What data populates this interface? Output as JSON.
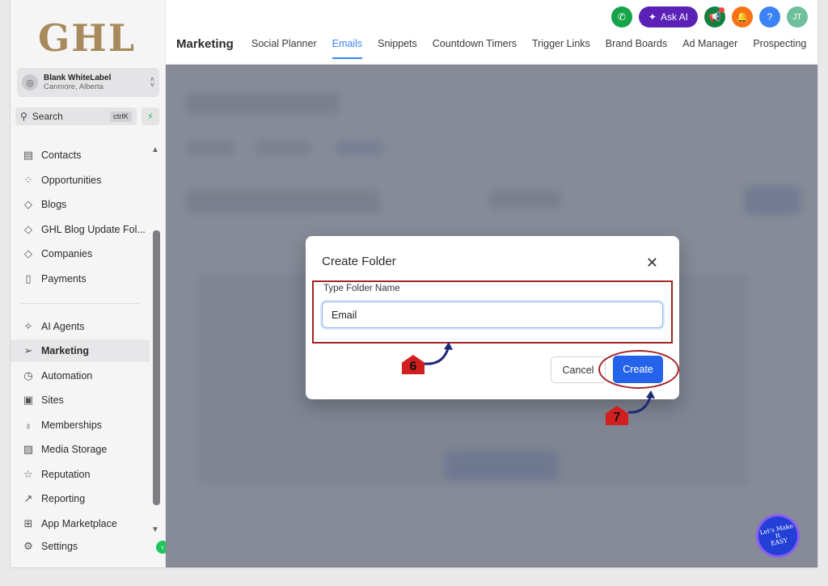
{
  "logo": "GHL",
  "account": {
    "name": "Blank WhiteLabel",
    "location": "Canmore, Alberta"
  },
  "search": {
    "label": "Search",
    "shortcut": "ctrlK"
  },
  "sidebar": {
    "items": [
      {
        "label": "Contacts",
        "icon": "contacts-icon"
      },
      {
        "label": "Opportunities",
        "icon": "opportunities-icon"
      },
      {
        "label": "Blogs",
        "icon": "blogs-icon"
      },
      {
        "label": "GHL Blog Update Fol...",
        "icon": "folder-icon"
      },
      {
        "label": "Companies",
        "icon": "companies-icon"
      },
      {
        "label": "Payments",
        "icon": "payments-icon"
      },
      {
        "label": "AI Agents",
        "icon": "sparkle-icon"
      },
      {
        "label": "Marketing",
        "icon": "send-icon"
      },
      {
        "label": "Automation",
        "icon": "automation-icon"
      },
      {
        "label": "Sites",
        "icon": "sites-icon"
      },
      {
        "label": "Memberships",
        "icon": "memberships-icon"
      },
      {
        "label": "Media Storage",
        "icon": "image-icon"
      },
      {
        "label": "Reputation",
        "icon": "star-icon"
      },
      {
        "label": "Reporting",
        "icon": "chart-icon"
      },
      {
        "label": "App Marketplace",
        "icon": "grid-icon"
      },
      {
        "label": "Settings",
        "icon": "gear-icon"
      }
    ]
  },
  "header": {
    "ask_ai": "Ask AI",
    "avatar": "JT",
    "help": "?",
    "page_title": "Marketing",
    "tabs": [
      "Social Planner",
      "Emails",
      "Snippets",
      "Countdown Timers",
      "Trigger Links",
      "Brand Boards",
      "Ad Manager",
      "Prospecting"
    ],
    "active_tab": "Emails"
  },
  "modal": {
    "title": "Create Folder",
    "field_label": "Type Folder Name",
    "field_value": "Email",
    "cancel": "Cancel",
    "create": "Create"
  },
  "annotations": {
    "step_6": "6",
    "step_7": "7"
  },
  "badge": {
    "line1": "Let's Make",
    "line2": "It",
    "line3": "EASY"
  },
  "colors": {
    "accent": "#3b82f6",
    "create_button": "#2563eb",
    "highlight": "#a32525",
    "ask_ai": "#5b21b6"
  }
}
